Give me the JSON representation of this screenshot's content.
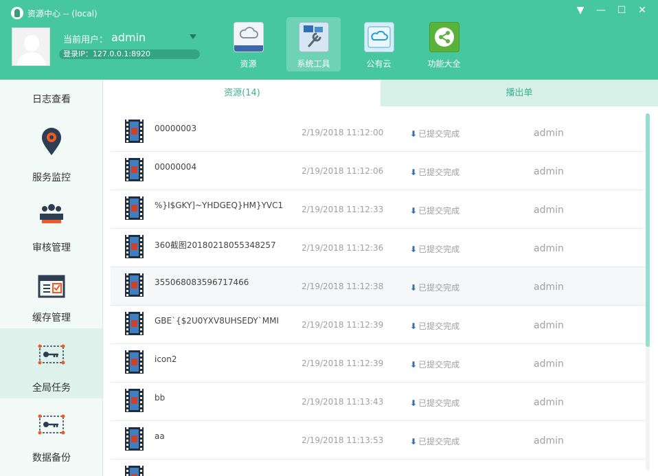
{
  "window": {
    "title": "资源中心 -- (local)",
    "controls": [
      "▼",
      "—",
      "☐",
      "✕"
    ]
  },
  "user": {
    "label": "当前用户：",
    "name": "admin",
    "login_ip": "登录IP：127.0.0.1:8920"
  },
  "toolbar": {
    "items": [
      {
        "label": "资源",
        "icon": "cloud-disk-icon"
      },
      {
        "label": "系统工具",
        "icon": "tools-icon",
        "active": true
      },
      {
        "label": "公有云",
        "icon": "public-cloud-icon"
      },
      {
        "label": "功能大全",
        "icon": "share-nodes-icon"
      }
    ]
  },
  "sidebar": {
    "items": [
      {
        "label": "日志查看",
        "icon": "log-icon"
      },
      {
        "label": "服务监控",
        "icon": "location-gear-icon"
      },
      {
        "label": "审核管理",
        "icon": "users-review-icon"
      },
      {
        "label": "缓存管理",
        "icon": "cache-window-icon"
      },
      {
        "label": "全局任务",
        "icon": "key-task-icon",
        "active": true
      },
      {
        "label": "数据备份",
        "icon": "key-backup-icon"
      }
    ]
  },
  "tabs": {
    "resources": "资源(14)",
    "playlist": "播出单"
  },
  "list": {
    "status_arrow": "⬇",
    "rows": [
      {
        "name": "00000003",
        "time": "2/19/2018 11:12:00",
        "status": "已提交完成",
        "user": "admin"
      },
      {
        "name": "00000004",
        "time": "2/19/2018 11:12:06",
        "status": "已提交完成",
        "user": "admin"
      },
      {
        "name": "%}I$GKY]~YHDGEQ}HM}YVC1",
        "time": "2/19/2018 11:12:33",
        "status": "已提交完成",
        "user": "admin"
      },
      {
        "name": "360截图20180218055348257",
        "time": "2/19/2018 11:12:36",
        "status": "已提交完成",
        "user": "admin"
      },
      {
        "name": "355068083596717466",
        "time": "2/19/2018 11:12:38",
        "status": "已提交完成",
        "user": "admin"
      },
      {
        "name": "GBE`{$2U0YXV8UHSEDY`MMI",
        "time": "2/19/2018 11:12:39",
        "status": "已提交完成",
        "user": "admin"
      },
      {
        "name": "icon2",
        "time": "2/19/2018 11:12:39",
        "status": "已提交完成",
        "user": "admin"
      },
      {
        "name": "bb",
        "time": "2/19/2018 11:13:43",
        "status": "已提交完成",
        "user": "admin"
      },
      {
        "name": "aa",
        "time": "2/19/2018 11:13:53",
        "status": "已提交完成",
        "user": "admin"
      }
    ]
  },
  "colors": {
    "header": "#46c79e",
    "accent": "#39b48e",
    "sidebar_bg": "#f1faf7",
    "active_tab_bg": "#d8f1e8"
  }
}
